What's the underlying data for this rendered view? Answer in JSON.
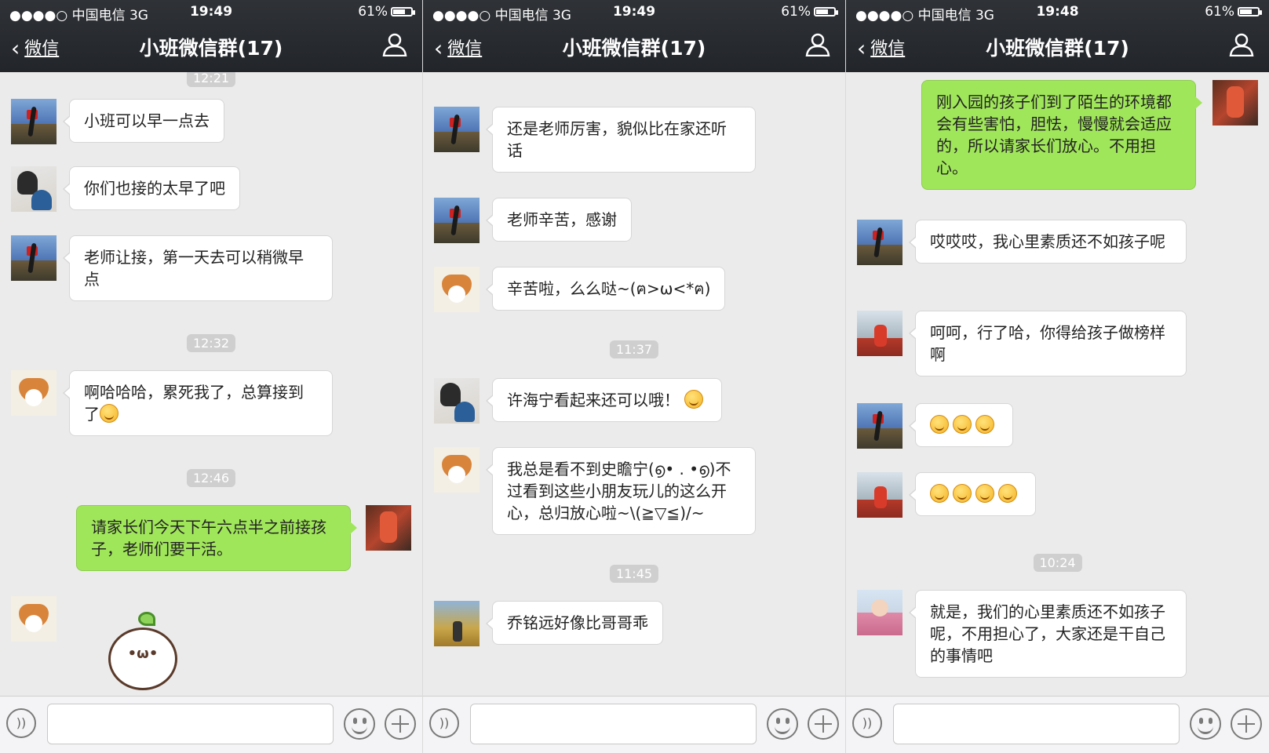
{
  "screens": [
    {
      "status": {
        "carrier": "●●●●○ 中国电信  3G",
        "time": "19:49",
        "battery": "61%"
      },
      "nav": {
        "back_label": "微信",
        "title": "小班微信群(17)"
      },
      "timestamps": [
        "12:21",
        "12:32",
        "12:46"
      ],
      "messages": [
        {
          "text": "小班可以早一点去"
        },
        {
          "text": "你们也接的太早了吧"
        },
        {
          "text": "老师让接，第一天去可以稍微早点"
        },
        {
          "text": "啊哈哈哈，累死我了，总算接到了"
        },
        {
          "text": "请家长们今天下午六点半之前接孩子，老师们要干活。"
        }
      ],
      "sticker_face": "•ω•"
    },
    {
      "status": {
        "carrier": "●●●●○ 中国电信  3G",
        "time": "19:49",
        "battery": "61%"
      },
      "nav": {
        "back_label": "微信",
        "title": "小班微信群(17)"
      },
      "timestamps": [
        "11:37",
        "11:45"
      ],
      "messages": [
        {
          "text": "还是老师厉害，貌似比在家还听话"
        },
        {
          "text": "老师辛苦，感谢"
        },
        {
          "text": "辛苦啦，么么哒~(ฅ>ω<*ฅ)"
        },
        {
          "text": "许海宁看起来还可以哦！"
        },
        {
          "text": "我总是看不到史瞻宁(൭• . •൭)不过看到这些小朋友玩儿的这么开心，总归放心啦~\\(≧▽≦)/~"
        },
        {
          "text": "乔铭远好像比哥哥乖"
        }
      ]
    },
    {
      "status": {
        "carrier": "●●●●○ 中国电信  3G",
        "time": "19:48",
        "battery": "61%"
      },
      "nav": {
        "back_label": "微信",
        "title": "小班微信群(17)"
      },
      "timestamps": [
        "10:24"
      ],
      "messages": [
        {
          "text": "刚入园的孩子们到了陌生的环境都会有些害怕，胆怯，慢慢就会适应的，所以请家长们放心。不用担心。"
        },
        {
          "text": "哎哎哎，我心里素质还不如孩子呢"
        },
        {
          "text": "呵呵，行了哈，你得给孩子做榜样啊"
        },
        {
          "text": ""
        },
        {
          "text": ""
        },
        {
          "text": "就是，我们的心里素质还不如孩子呢，不用担心了，大家还是干自己的事情吧"
        }
      ]
    }
  ],
  "icons": {
    "back": "chevron-left-icon",
    "group_members": "people-icon",
    "voice": "voice-icon",
    "emoji": "smile-icon",
    "more": "plus-icon",
    "emoji_in_message": "grin-emoji-icon"
  },
  "colors": {
    "outgoing_bubble": "#a0e65a",
    "incoming_bubble": "#ffffff",
    "nav_bar": "#2a2d31",
    "chat_bg": "#ebebeb"
  },
  "battery_level": 0.61
}
